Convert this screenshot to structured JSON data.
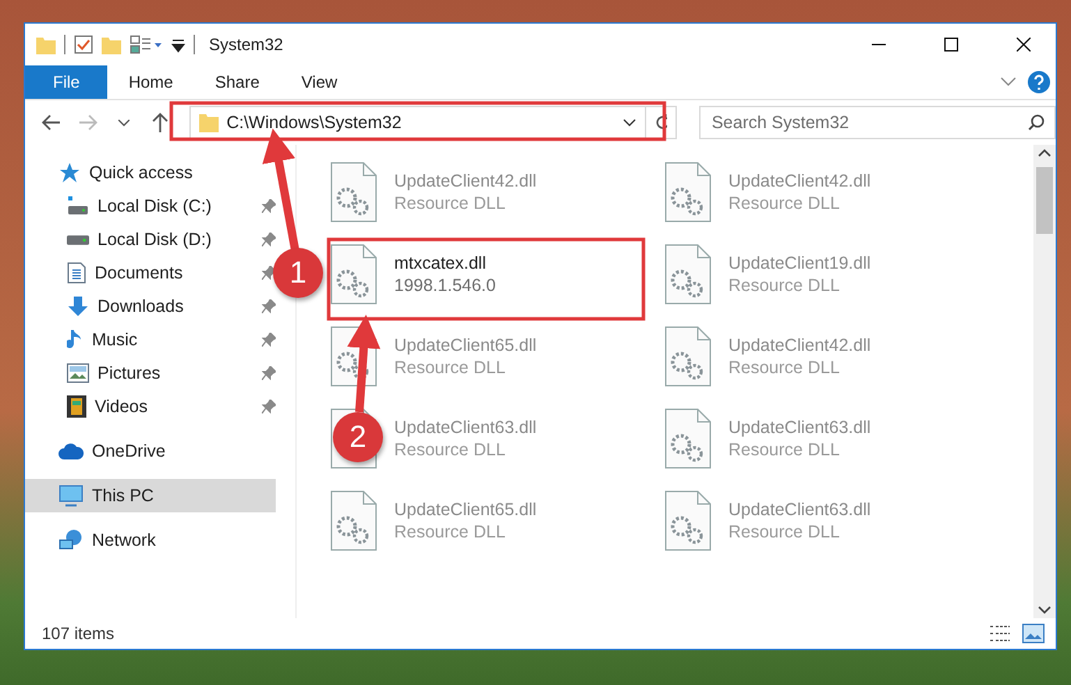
{
  "window": {
    "title": "System32"
  },
  "ribbon": {
    "tabs": [
      {
        "label": "File",
        "selected": true
      },
      {
        "label": "Home",
        "selected": false
      },
      {
        "label": "Share",
        "selected": false
      },
      {
        "label": "View",
        "selected": false
      }
    ]
  },
  "address": {
    "path": "C:\\Windows\\System32"
  },
  "search": {
    "placeholder": "Search System32"
  },
  "sidebar": {
    "items": [
      {
        "label": "Quick access",
        "selected": false,
        "children": [
          {
            "label": "Local Disk (C:)",
            "pinned": true,
            "selected": false
          },
          {
            "label": "Local Disk (D:)",
            "pinned": true,
            "selected": false
          },
          {
            "label": "Documents",
            "pinned": true,
            "selected": false
          },
          {
            "label": "Downloads",
            "pinned": true,
            "selected": false
          },
          {
            "label": "Music",
            "pinned": true,
            "selected": false
          },
          {
            "label": "Pictures",
            "pinned": true,
            "selected": false
          },
          {
            "label": "Videos",
            "pinned": true,
            "selected": false
          }
        ]
      },
      {
        "label": "OneDrive",
        "selected": false
      },
      {
        "label": "This PC",
        "selected": true
      },
      {
        "label": "Network",
        "selected": false
      }
    ]
  },
  "files": [
    {
      "name": "UpdateClient42.dll",
      "detail": "Resource DLL",
      "blurred": true
    },
    {
      "name": "UpdateClient42.dll",
      "detail": "Resource DLL",
      "blurred": true
    },
    {
      "name": "mtxcatex.dll",
      "detail": "1998.1.546.0",
      "blurred": false
    },
    {
      "name": "UpdateClient19.dll",
      "detail": "Resource DLL",
      "blurred": true
    },
    {
      "name": "UpdateClient65.dll",
      "detail": "Resource DLL",
      "blurred": true
    },
    {
      "name": "UpdateClient42.dll",
      "detail": "Resource DLL",
      "blurred": true
    },
    {
      "name": "UpdateClient63.dll",
      "detail": "Resource DLL",
      "blurred": true
    },
    {
      "name": "UpdateClient63.dll",
      "detail": "Resource DLL",
      "blurred": true
    },
    {
      "name": "UpdateClient65.dll",
      "detail": "Resource DLL",
      "blurred": true
    },
    {
      "name": "UpdateClient63.dll",
      "detail": "Resource DLL",
      "blurred": true
    }
  ],
  "status_bar": {
    "count": "107 items"
  },
  "annotations": [
    {
      "number": "1"
    },
    {
      "number": "2"
    }
  ]
}
